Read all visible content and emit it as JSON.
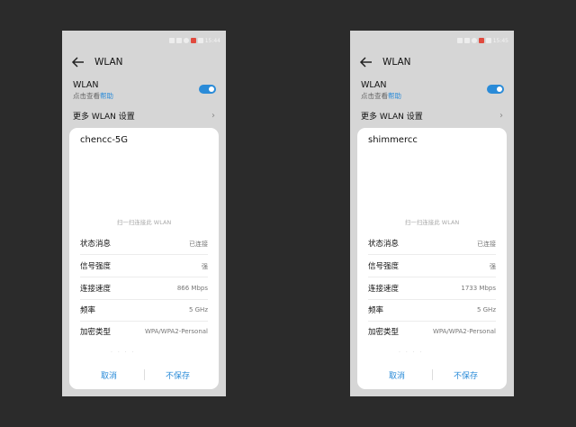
{
  "screens": [
    {
      "status_time": "15:44",
      "title": "WLAN",
      "wlan_label": "WLAN",
      "help_prefix": "点击查看",
      "help_link": "帮助",
      "more_settings": "更多 WLAN 设置",
      "dialog": {
        "network_name": "chencc-5G",
        "qr_hint": "扫一扫连接此 WLAN",
        "rows": [
          {
            "label": "状态消息",
            "value": "已连接"
          },
          {
            "label": "信号强度",
            "value": "强"
          },
          {
            "label": "连接速度",
            "value": "866 Mbps"
          },
          {
            "label": "频率",
            "value": "5 GHz"
          },
          {
            "label": "加密类型",
            "value": "WPA/WPA2-Personal"
          }
        ],
        "cancel": "取消",
        "nosave": "不保存"
      }
    },
    {
      "status_time": "15:45",
      "title": "WLAN",
      "wlan_label": "WLAN",
      "help_prefix": "点击查看",
      "help_link": "帮助",
      "more_settings": "更多 WLAN 设置",
      "dialog": {
        "network_name": "shimmercc",
        "qr_hint": "扫一扫连接此 WLAN",
        "rows": [
          {
            "label": "状态消息",
            "value": "已连接"
          },
          {
            "label": "信号强度",
            "value": "强"
          },
          {
            "label": "连接速度",
            "value": "1733 Mbps"
          },
          {
            "label": "频率",
            "value": "5 GHz"
          },
          {
            "label": "加密类型",
            "value": "WPA/WPA2-Personal"
          }
        ],
        "cancel": "取消",
        "nosave": "不保存"
      }
    }
  ],
  "colors": {
    "background": "#2b2b2b",
    "phone_bg": "#d6d6d6",
    "accent": "#2a8bd8",
    "dialog_bg": "#ffffff"
  },
  "icons": [
    "back-arrow-icon",
    "chevron-right-icon",
    "wifi-toggle"
  ]
}
